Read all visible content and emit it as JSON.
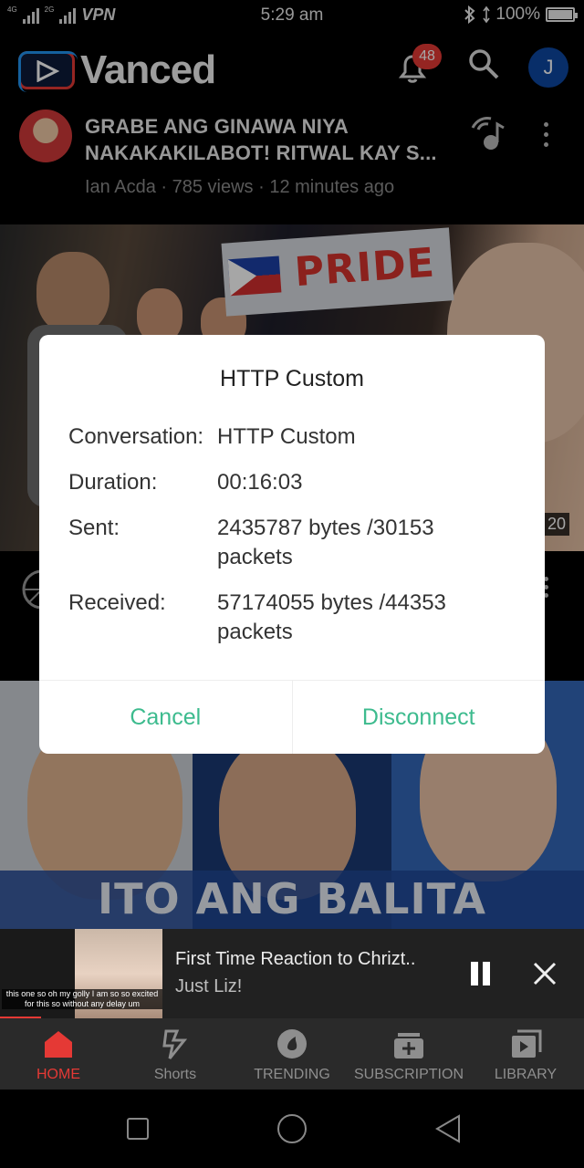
{
  "status_bar": {
    "net1": "4G",
    "net2": "2G",
    "vpn": "VPN",
    "time": "5:29 am",
    "battery": "100%"
  },
  "header": {
    "app_name": "Vanced",
    "notification_count": "48",
    "avatar_letter": "J"
  },
  "video": {
    "title": "GRABE ANG GINAWA NIYA NAKAKAKILABOT! RITWAL KAY S...",
    "meta": "Ian Acda · 785 views · 12 minutes ago",
    "thumbnail_text": "PRIDE",
    "duration_partial": "20"
  },
  "thumbnail2": {
    "caption": "ITO ANG BALITA"
  },
  "dialog": {
    "title": "HTTP Custom",
    "rows": [
      {
        "key": "Conversation:",
        "value": "HTTP Custom"
      },
      {
        "key": "Duration:",
        "value": "00:16:03"
      },
      {
        "key": "Sent:",
        "value": "2435787 bytes /30153 packets"
      },
      {
        "key": "Received:",
        "value": "57174055 bytes /44353 packets"
      }
    ],
    "cancel_label": "Cancel",
    "disconnect_label": "Disconnect",
    "accent_color": "#3dbb8e"
  },
  "mini_player": {
    "title": "First Time Reaction to Chrizt..",
    "channel": "Just Liz!",
    "caption": "this one so oh my golly I am so so excited for this so without any delay um",
    "progress": 0.07
  },
  "bottom_nav": {
    "items": [
      {
        "label": "HOME",
        "icon": "home-icon",
        "active": true
      },
      {
        "label": "Shorts",
        "icon": "shorts-icon",
        "active": false
      },
      {
        "label": "TRENDING",
        "icon": "trending-icon",
        "active": false
      },
      {
        "label": "SUBSCRIPTION",
        "icon": "subscription-icon",
        "active": false
      },
      {
        "label": "LIBRARY",
        "icon": "library-icon",
        "active": false
      }
    ],
    "active_color": "#e53935"
  }
}
